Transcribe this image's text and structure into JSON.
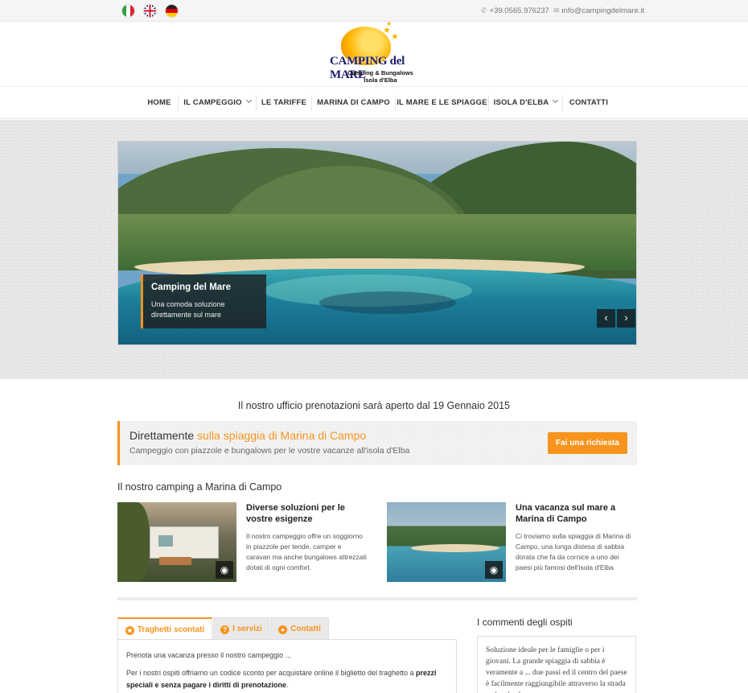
{
  "topbar": {
    "flags": [
      "italiano-flag",
      "english-flag",
      "deutsch-flag"
    ],
    "phone": "+39.0565.976237",
    "email": "info@campingdelmare.it"
  },
  "logo": {
    "title": "CAMPING del MARE",
    "line1": "Camping & Bungalows",
    "line2": "Isola d'Elba"
  },
  "nav": {
    "items": [
      {
        "label": "HOME"
      },
      {
        "label": "IL CAMPEGGIO"
      },
      {
        "label": "LE TARIFFE"
      },
      {
        "label": "MARINA DI CAMPO"
      },
      {
        "label": "IL MARE E LE SPIAGGE"
      },
      {
        "label": "ISOLA D'ELBA"
      },
      {
        "label": "CONTATTI"
      }
    ]
  },
  "hero": {
    "caption_title": "Camping del Mare",
    "caption_text": "Una comoda soluzione direttamente sul mare",
    "prev": "‹",
    "next": "›"
  },
  "announcement": "Il nostro ufficio prenotazioni sarà aperto dal 19 Gennaio 2015",
  "callout": {
    "title_plain": "Direttamente ",
    "title_highlight": "sulla spiaggia di Marina di Campo",
    "subtitle": "Campeggio con piazzole e bungalows per le vostre vacanze all'isola d'Elba",
    "button": "Fai una richiesta"
  },
  "camping": {
    "title": "Il nostro camping a Marina di Campo",
    "features": [
      {
        "title": "Diverse soluzioni per le vostre esigenze",
        "text": "Il nostro campeggio offre un soggiorno in piazzole per tende, camper e caravan ma anche bungalows attrezzati dotati di ogni comfort."
      },
      {
        "title": "Una vacanza sul mare a Marina di Campo",
        "text": "Ci troviamo sulla spiaggia di Marina di Campo, una lunga distesa di sabbia dorata che fa da cornice a uno dei paesi più famosi dell'isola d'Elba"
      }
    ]
  },
  "tabs": {
    "items": [
      {
        "label": "Traghetti scontati",
        "icon": "★"
      },
      {
        "label": "I servizi",
        "icon": "?"
      },
      {
        "label": "Contatti",
        "icon": "●"
      }
    ],
    "panel_p1": "Prenota una vacanza presso il nostro campeggio ...",
    "panel_p2_plain": "Per i nostri ospiti offriamo un codice sconto per acquistare online il biglietto del traghetto a ",
    "panel_p2_bold": "prezzi speciali e senza pagare i diritti di prenotazione",
    "panel_p2_end": "."
  },
  "comments": {
    "title": "I commenti degli ospiti",
    "text": "Soluzione ideale per le famiglie o per i giovani. La grande spiaggia di sabbia è veramente a ... due passi ed il centro del paese è facilmente raggiungibile attraverso la strada pedonale che"
  },
  "colors": {
    "accent": "#f7941d",
    "text": "#333333",
    "nav_text": "#333333"
  }
}
